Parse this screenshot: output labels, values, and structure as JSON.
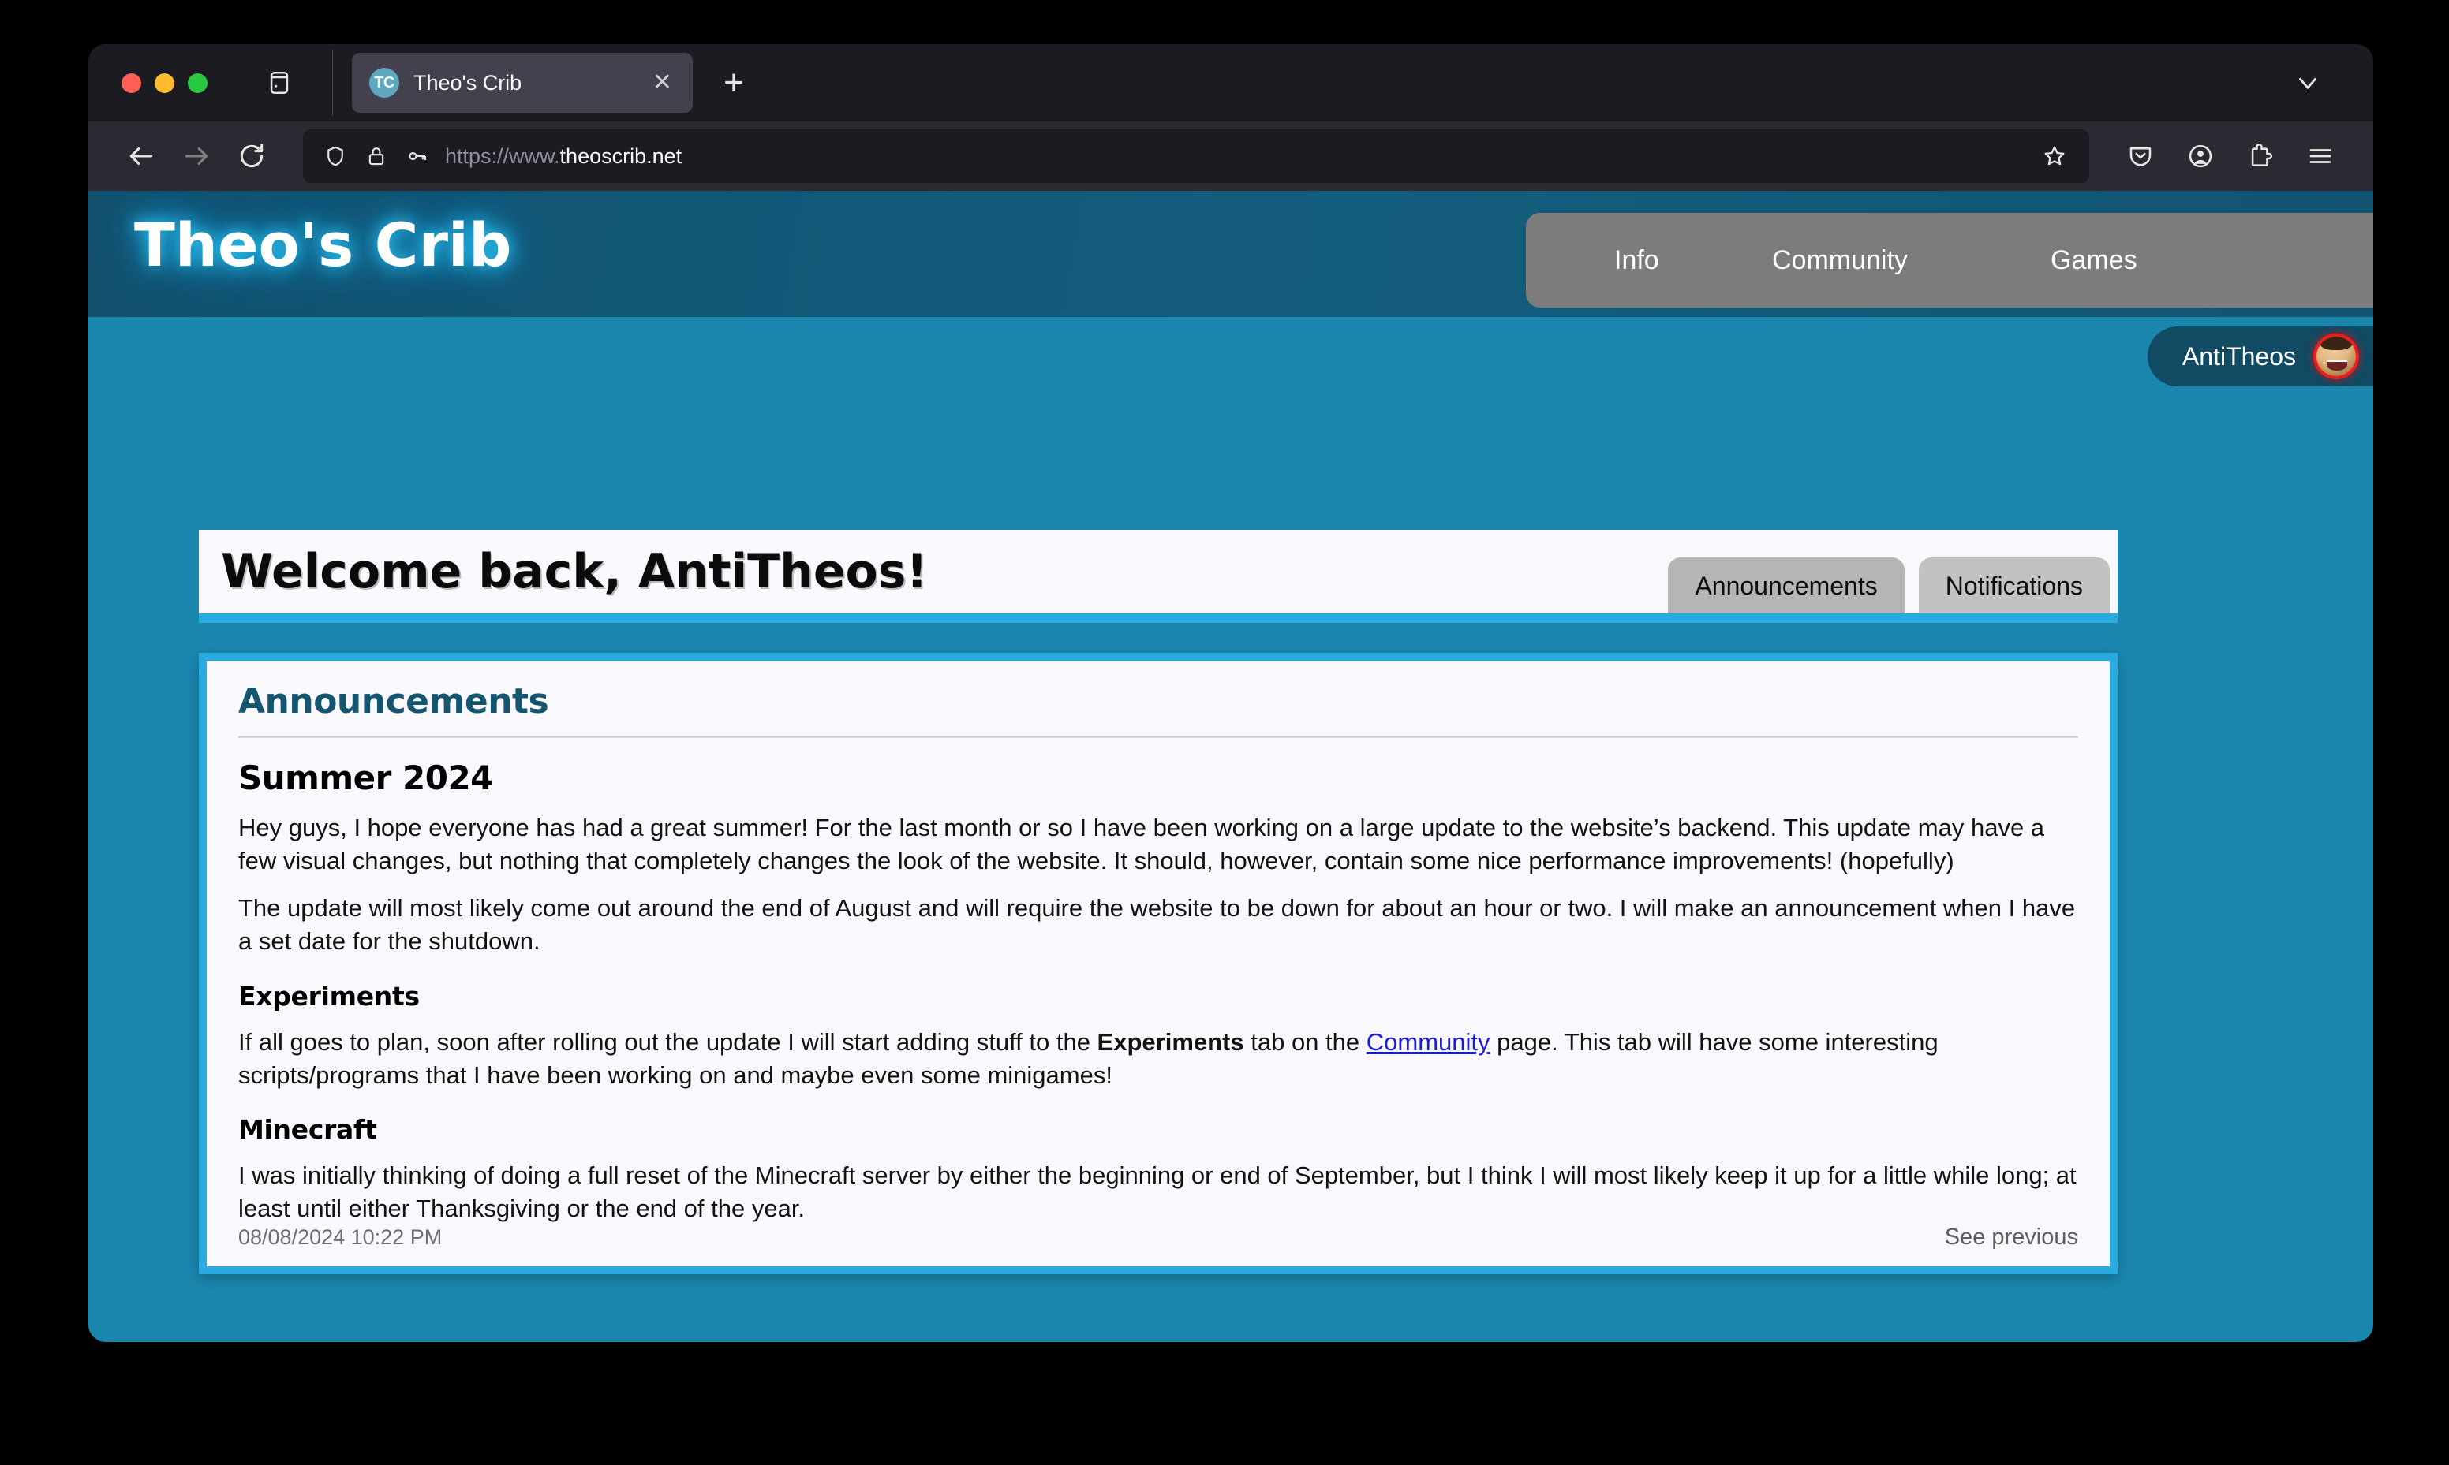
{
  "browser": {
    "tab": {
      "favicon_text": "TC",
      "title": "Theo's Crib",
      "close_label": "✕"
    },
    "new_tab_label": "+",
    "url": {
      "scheme": "https://www.",
      "host": "theoscrib.net"
    },
    "icons": {
      "back": "back-arrow-icon",
      "forward": "forward-arrow-icon",
      "reload": "reload-icon",
      "sidebar": "sidebar-icon",
      "shield": "shield-icon",
      "lock": "lock-icon",
      "key": "key-icon",
      "bookmark": "star-icon",
      "pocket": "pocket-icon",
      "account": "account-icon",
      "extensions": "extensions-icon",
      "menu": "hamburger-menu-icon",
      "list_all_tabs": "chevron-down-icon"
    }
  },
  "site": {
    "logo": "Theo's Crib",
    "nav": [
      {
        "label": "Info"
      },
      {
        "label": "Community"
      },
      {
        "label": "Games"
      }
    ],
    "user": {
      "name": "AntiTheos"
    },
    "welcome": {
      "title": "Welcome back, AntiTheos!"
    },
    "tabs": [
      {
        "label": "Announcements",
        "active": true
      },
      {
        "label": "Notifications",
        "active": false
      }
    ]
  },
  "panel": {
    "title": "Announcements",
    "post": {
      "title": "Summer 2024",
      "paragraph_1": "Hey guys, I hope everyone has had a great summer! For the last month or so I have been working on a large update to the website’s backend. This update may have a few visual changes, but nothing that completely changes the look of the website. It should, however, contain some nice performance improvements! (hopefully)",
      "paragraph_2": "The update will most likely come out around the end of August and will require the website to be down for about an hour or two. I will make an announcement when I have a set date for the shutdown.",
      "section_experiments_title": "Experiments",
      "experiments_part_1": "If all goes to plan, soon after rolling out the update I will start adding stuff to the ",
      "experiments_bold": "Experiments",
      "experiments_part_2": " tab on the ",
      "experiments_link": "Community",
      "experiments_part_3": " page. This tab will have some interesting scripts/programs that I have been working on and maybe even some minigames!",
      "section_minecraft_title": "Minecraft",
      "minecraft_paragraph": "I was initially thinking of doing a full reset of the Minecraft server by either the beginning or end of September, but I think I will most likely keep it up for a little while long; at least until either Thanksgiving or the end of the year.",
      "timestamp": "08/08/2024 10:22 PM",
      "see_previous": "See previous"
    }
  },
  "colors": {
    "page_bg": "#1b86ad",
    "header_bg": "#12506e",
    "accent_cyan": "#29abe2",
    "panel_bg": "#f9f9fd",
    "nav_pill": "#7c7c7c",
    "link": "#1a1ae0",
    "avatar_ring": "#ef1b1b"
  }
}
